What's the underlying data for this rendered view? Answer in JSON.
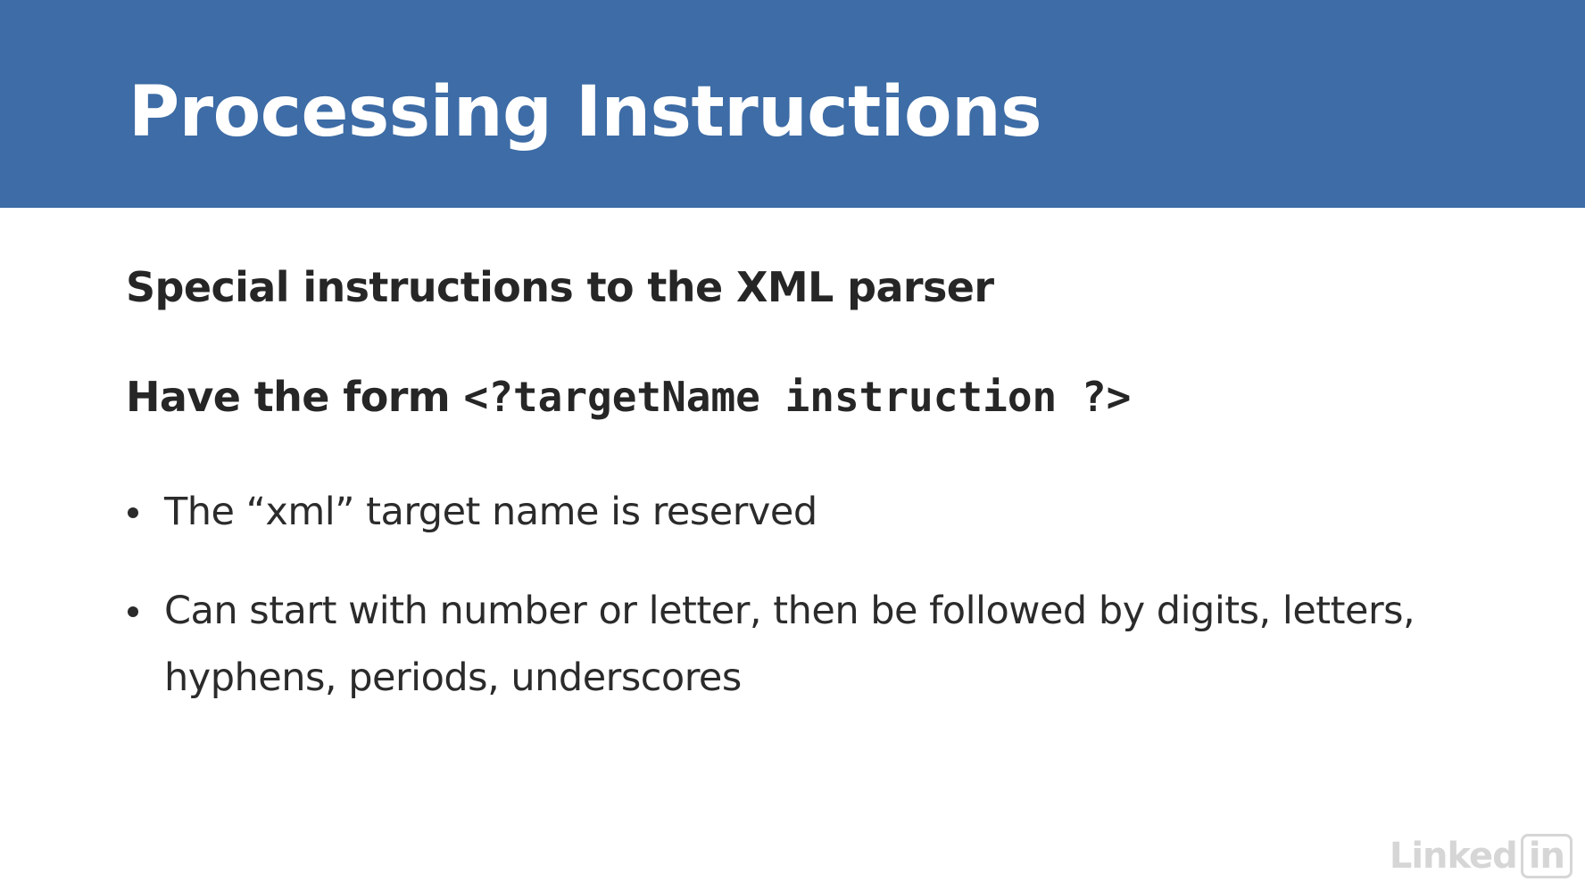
{
  "slide": {
    "title": "Processing Instructions",
    "line1": "Special instructions to the XML parser",
    "line2_prefix": "Have the form ",
    "line2_code": "<?targetName instruction ?>",
    "bullets": [
      "The “xml” target name is reserved",
      "Can start with number or letter, then be followed by digits, letters, hyphens, periods, underscores"
    ]
  },
  "logo": {
    "text": "Linked",
    "box_text": "in"
  },
  "colors": {
    "header_bg": "#3d6ca6",
    "title_text": "#ffffff",
    "body_text": "#262626",
    "logo": "#d6d6d6"
  }
}
